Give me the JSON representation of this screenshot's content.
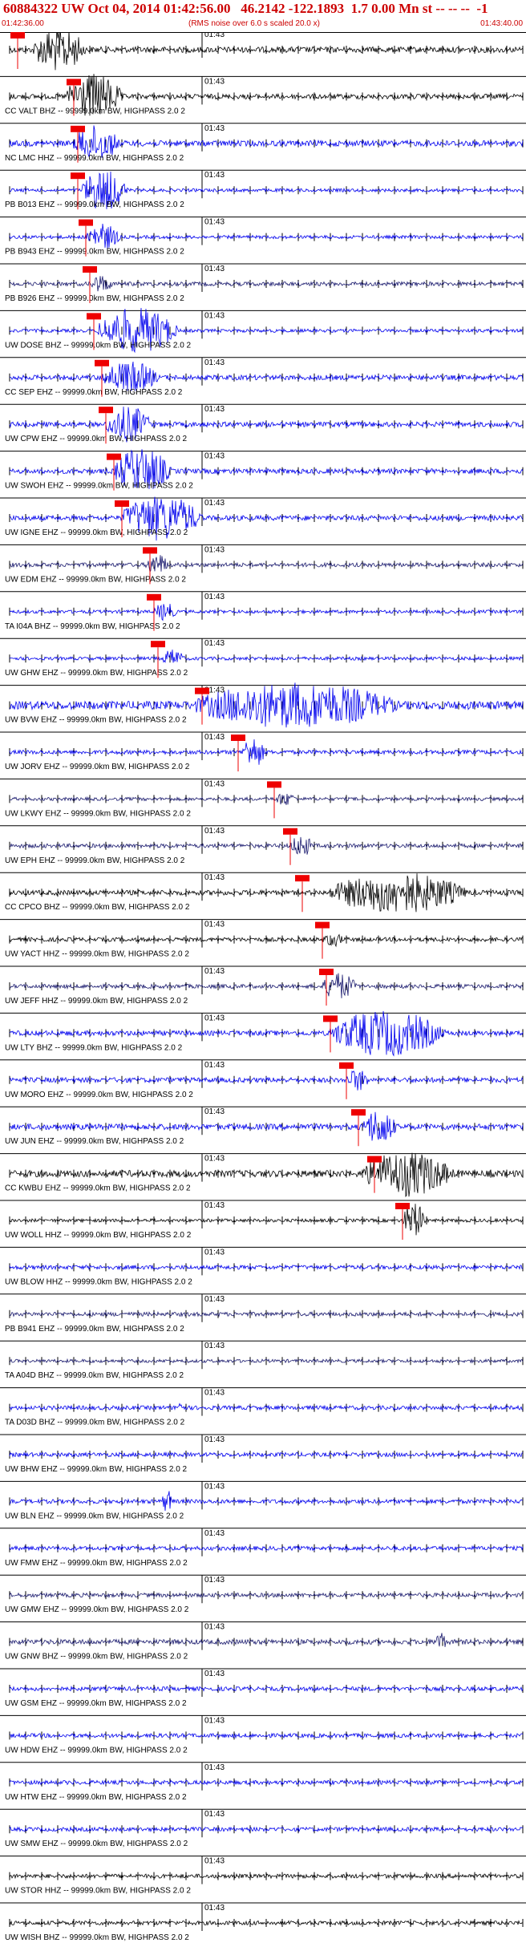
{
  "header": {
    "title": "60884322 UW Oct 04, 2014 01:42:56.00   46.2142 -122.1893  1.7 0.00 Mn st -- -- --  -1",
    "start_time": "01:42:36.00",
    "noise_note": "(RMS noise over 6.0 s scaled 20.0 x)",
    "end_time": "01:43:40.00"
  },
  "colors": {
    "black_trace": "#000000",
    "blue_trace": "#0000ee",
    "navy_trace": "#1a1a6e",
    "pick_box": "#ee0000",
    "pick_line": "#ee0000",
    "title": "#cc0000"
  },
  "chart_data": {
    "type": "line",
    "title": "60884322 UW Oct 04, 2014 01:42:56.00",
    "x_start": "01:42:36.00",
    "x_end": "01:43:40.00",
    "x_range_seconds": [
      0,
      64
    ],
    "tick_label": "01:43",
    "tick_label_second": 24,
    "traces": [
      {
        "label": "",
        "amp": 0.35,
        "color": "black",
        "burst": [
          3,
          9,
          1.0
        ],
        "pick": 1.0
      },
      {
        "label": "CC VALT BHZ -- 99999.0km BW, HIGHPASS  2.0  2",
        "amp": 0.3,
        "color": "black",
        "burst": [
          7,
          10,
          1.0
        ],
        "pick": 8.0
      },
      {
        "label": "NC LMC HHZ -- 99999.0km BW, HIGHPASS  2.0  2",
        "amp": 0.35,
        "color": "blue",
        "burst": [
          8,
          8,
          0.8
        ],
        "pick": 8.5
      },
      {
        "label": "PB B013 EHZ -- 99999.0km BW, HIGHPASS  2.0  2",
        "amp": 0.2,
        "color": "blue",
        "burst": [
          9,
          8,
          0.9
        ],
        "pick": 8.5
      },
      {
        "label": "PB B943 EHZ -- 99999.0km BW, HIGHPASS  2.0  2",
        "amp": 0.2,
        "color": "blue",
        "burst": [
          9.5,
          6,
          0.6
        ],
        "pick": 9.5
      },
      {
        "label": "PB B926 EHZ -- 99999.0km BW, HIGHPASS  2.0  2",
        "amp": 0.25,
        "color": "navy",
        "burst": [
          10,
          4,
          0.4
        ],
        "pick": 10.0
      },
      {
        "label": "UW DOSE BHZ -- 99999.0km BW, HIGHPASS  2.0  2",
        "amp": 0.2,
        "color": "blue",
        "burst": [
          11,
          14,
          1.0
        ],
        "pick": 10.5
      },
      {
        "label": "CC SEP EHZ -- 99999.0km BW, HIGHPASS  2.0  2",
        "amp": 0.3,
        "color": "blue",
        "burst": [
          11.5,
          10,
          0.7
        ],
        "pick": 11.5
      },
      {
        "label": "UW CPW EHZ -- 99999.0km BW, HIGHPASS  2.0  2",
        "amp": 0.3,
        "color": "blue",
        "burst": [
          12,
          8,
          0.8
        ],
        "pick": 12.0
      },
      {
        "label": "UW SWOH EHZ -- 99999.0km BW, HIGHPASS  2.0  2",
        "amp": 0.3,
        "color": "blue",
        "burst": [
          13,
          10,
          1.0
        ],
        "pick": 13.0
      },
      {
        "label": "UW IGNE EHZ -- 99999.0km BW, HIGHPASS  2.0  2",
        "amp": 0.3,
        "color": "blue",
        "burst": [
          14,
          14,
          1.0
        ],
        "pick": 14.0
      },
      {
        "label": "UW EDM EHZ -- 99999.0km BW, HIGHPASS  2.0  2",
        "amp": 0.25,
        "color": "navy",
        "burst": [
          17,
          4,
          0.5
        ],
        "pick": 17.5
      },
      {
        "label": "TA I04A BHZ -- 99999.0km BW, HIGHPASS  2.0  2",
        "amp": 0.2,
        "color": "blue",
        "burst": [
          18,
          4,
          0.4
        ],
        "pick": 18.0
      },
      {
        "label": "UW GHW EHZ -- 99999.0km BW, HIGHPASS  2.0  2",
        "amp": 0.2,
        "color": "blue",
        "burst": [
          19,
          4,
          0.4
        ],
        "pick": 18.5
      },
      {
        "label": "UW BVW EHZ -- 99999.0km BW, HIGHPASS  2.0  2",
        "amp": 0.5,
        "color": "blue",
        "burst": [
          23,
          36,
          1.0
        ],
        "pick": 24.0
      },
      {
        "label": "UW JORV EHZ -- 99999.0km BW, HIGHPASS  2.0  2",
        "amp": 0.25,
        "color": "blue",
        "burst": [
          29,
          4,
          0.7
        ],
        "pick": 28.5
      },
      {
        "label": "UW LKWY EHZ -- 99999.0km BW, HIGHPASS  2.0  2",
        "amp": 0.2,
        "color": "navy",
        "burst": [
          33,
          4,
          0.3
        ],
        "pick": 33.0
      },
      {
        "label": "UW EPH EHZ -- 99999.0km BW, HIGHPASS  2.0  2",
        "amp": 0.25,
        "color": "navy",
        "burst": [
          35,
          4,
          0.5
        ],
        "pick": 35.0
      },
      {
        "label": "CC CPCO BHZ -- 99999.0km BW, HIGHPASS  2.0  2",
        "amp": 0.3,
        "color": "black",
        "burst": [
          40,
          24,
          0.9
        ],
        "pick": 36.5
      },
      {
        "label": "UW YACT HHZ -- 99999.0km BW, HIGHPASS  2.0  2",
        "amp": 0.25,
        "color": "black",
        "burst": [
          39,
          4,
          0.3
        ],
        "pick": 39.0
      },
      {
        "label": "UW JEFF HHZ -- 99999.0km BW, HIGHPASS  2.0  2",
        "amp": 0.25,
        "color": "navy",
        "burst": [
          39,
          6,
          0.6
        ],
        "pick": 39.5
      },
      {
        "label": "UW LTY BHZ -- 99999.0km BW, HIGHPASS  2.0  2",
        "amp": 0.3,
        "color": "blue",
        "burst": [
          40,
          20,
          1.0
        ],
        "pick": 40.0
      },
      {
        "label": "UW MORO EHZ -- 99999.0km BW, HIGHPASS  2.0  2",
        "amp": 0.3,
        "color": "blue",
        "burst": [
          42,
          4,
          0.5
        ],
        "pick": 42.0
      },
      {
        "label": "UW JUN EHZ -- 99999.0km BW, HIGHPASS  2.0  2",
        "amp": 0.35,
        "color": "blue",
        "burst": [
          44,
          6,
          0.8
        ],
        "pick": 43.5
      },
      {
        "label": "CC KWBU EHZ -- 99999.0km BW, HIGHPASS  2.0  2",
        "amp": 0.4,
        "color": "black",
        "burst": [
          44,
          16,
          1.0
        ],
        "pick": 45.5
      },
      {
        "label": "UW WOLL HHZ -- 99999.0km BW, HIGHPASS  2.0  2",
        "amp": 0.2,
        "color": "black",
        "burst": [
          49,
          4,
          0.8
        ],
        "pick": 49.0
      },
      {
        "label": "UW BLOW HHZ -- 99999.0km BW, HIGHPASS  2.0  2",
        "amp": 0.25,
        "color": "blue",
        "burst": null,
        "pick": null
      },
      {
        "label": "PB B941 EHZ -- 99999.0km BW, HIGHPASS  2.0  2",
        "amp": 0.25,
        "color": "navy",
        "burst": null,
        "pick": null
      },
      {
        "label": "TA A04D BHZ -- 99999.0km BW, HIGHPASS  2.0  2",
        "amp": 0.2,
        "color": "navy",
        "burst": null,
        "pick": null
      },
      {
        "label": "TA D03D BHZ -- 99999.0km BW, HIGHPASS  2.0  2",
        "amp": 0.25,
        "color": "blue",
        "burst": [
          21,
          1,
          0.6
        ],
        "pick": null
      },
      {
        "label": "UW BHW EHZ -- 99999.0km BW, HIGHPASS  2.0  2",
        "amp": 0.25,
        "color": "blue",
        "burst": null,
        "pick": null
      },
      {
        "label": "UW BLN EHZ -- 99999.0km BW, HIGHPASS  2.0  2",
        "amp": 0.25,
        "color": "blue",
        "burst": [
          19,
          2,
          0.5
        ],
        "pick": null
      },
      {
        "label": "UW FMW EHZ -- 99999.0km BW, HIGHPASS  2.0  2",
        "amp": 0.25,
        "color": "blue",
        "burst": null,
        "pick": null
      },
      {
        "label": "UW GMW EHZ -- 99999.0km BW, HIGHPASS  2.0  2",
        "amp": 0.25,
        "color": "navy",
        "burst": null,
        "pick": null
      },
      {
        "label": "UW GNW BHZ -- 99999.0km BW, HIGHPASS  2.0  2",
        "amp": 0.3,
        "color": "navy",
        "burst": [
          53,
          2,
          0.5
        ],
        "pick": null
      },
      {
        "label": "UW GSM EHZ -- 99999.0km BW, HIGHPASS  2.0  2",
        "amp": 0.25,
        "color": "blue",
        "burst": null,
        "pick": null
      },
      {
        "label": "UW HDW EHZ -- 99999.0km BW, HIGHPASS  2.0  2",
        "amp": 0.25,
        "color": "blue",
        "burst": null,
        "pick": null
      },
      {
        "label": "UW HTW EHZ -- 99999.0km BW, HIGHPASS  2.0  2",
        "amp": 0.25,
        "color": "blue",
        "burst": null,
        "pick": null
      },
      {
        "label": "UW SMW EHZ -- 99999.0km BW, HIGHPASS  2.0  2",
        "amp": 0.25,
        "color": "blue",
        "burst": null,
        "pick": null
      },
      {
        "label": "UW STOR HHZ -- 99999.0km BW, HIGHPASS  2.0  2",
        "amp": 0.25,
        "color": "black",
        "burst": null,
        "pick": null
      },
      {
        "label": "UW WISH BHZ -- 99999.0km BW, HIGHPASS  2.0  2",
        "amp": 0.25,
        "color": "black",
        "burst": null,
        "pick": null
      }
    ]
  }
}
